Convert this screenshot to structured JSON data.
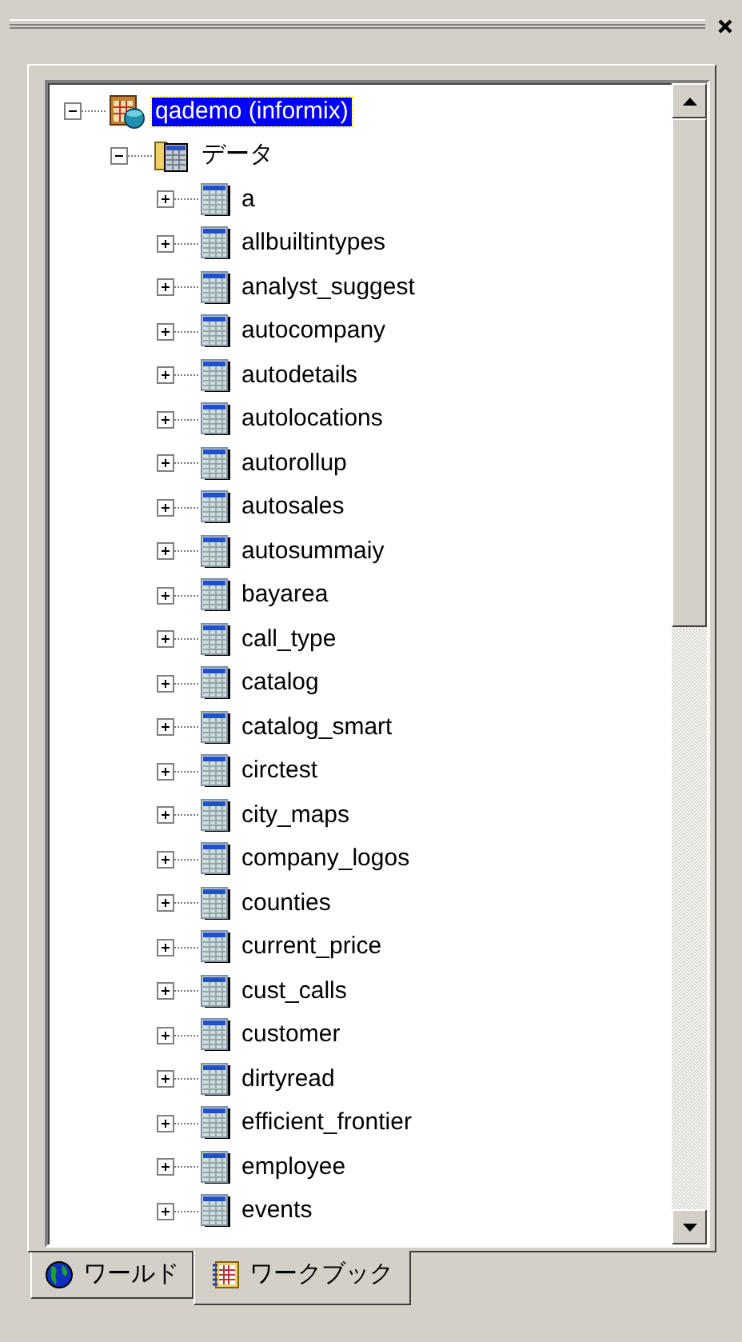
{
  "tree": [
    {
      "label": "qademo (informix)",
      "kind": "database",
      "expanded": true,
      "selected": true,
      "children": [
        {
          "label": "データ",
          "kind": "folder",
          "expanded": true,
          "selected": false,
          "children": [
            {
              "label": "a",
              "kind": "table",
              "expanded": false,
              "selected": false
            },
            {
              "label": "allbuiltintypes",
              "kind": "table",
              "expanded": false,
              "selected": false
            },
            {
              "label": "analyst_suggest",
              "kind": "table",
              "expanded": false,
              "selected": false
            },
            {
              "label": "autocompany",
              "kind": "table",
              "expanded": false,
              "selected": false
            },
            {
              "label": "autodetails",
              "kind": "table",
              "expanded": false,
              "selected": false
            },
            {
              "label": "autolocations",
              "kind": "table",
              "expanded": false,
              "selected": false
            },
            {
              "label": "autorollup",
              "kind": "table",
              "expanded": false,
              "selected": false
            },
            {
              "label": "autosales",
              "kind": "table",
              "expanded": false,
              "selected": false
            },
            {
              "label": "autosummaiy",
              "kind": "table",
              "expanded": false,
              "selected": false
            },
            {
              "label": "bayarea",
              "kind": "table",
              "expanded": false,
              "selected": false
            },
            {
              "label": "call_type",
              "kind": "table",
              "expanded": false,
              "selected": false
            },
            {
              "label": "catalog",
              "kind": "table",
              "expanded": false,
              "selected": false
            },
            {
              "label": "catalog_smart",
              "kind": "table",
              "expanded": false,
              "selected": false
            },
            {
              "label": "circtest",
              "kind": "table",
              "expanded": false,
              "selected": false
            },
            {
              "label": "city_maps",
              "kind": "table",
              "expanded": false,
              "selected": false
            },
            {
              "label": "company_logos",
              "kind": "table",
              "expanded": false,
              "selected": false
            },
            {
              "label": "counties",
              "kind": "table",
              "expanded": false,
              "selected": false
            },
            {
              "label": "current_price",
              "kind": "table",
              "expanded": false,
              "selected": false
            },
            {
              "label": "cust_calls",
              "kind": "table",
              "expanded": false,
              "selected": false
            },
            {
              "label": "customer",
              "kind": "table",
              "expanded": false,
              "selected": false
            },
            {
              "label": "dirtyread",
              "kind": "table",
              "expanded": false,
              "selected": false
            },
            {
              "label": "efficient_frontier",
              "kind": "table",
              "expanded": false,
              "selected": false
            },
            {
              "label": "employee",
              "kind": "table",
              "expanded": false,
              "selected": false
            },
            {
              "label": "events",
              "kind": "table",
              "expanded": false,
              "selected": false
            }
          ]
        }
      ]
    }
  ],
  "tabs": [
    {
      "label": "ワールド",
      "kind": "globe",
      "selected": false
    },
    {
      "label": "ワークブック",
      "kind": "book",
      "selected": true
    }
  ]
}
